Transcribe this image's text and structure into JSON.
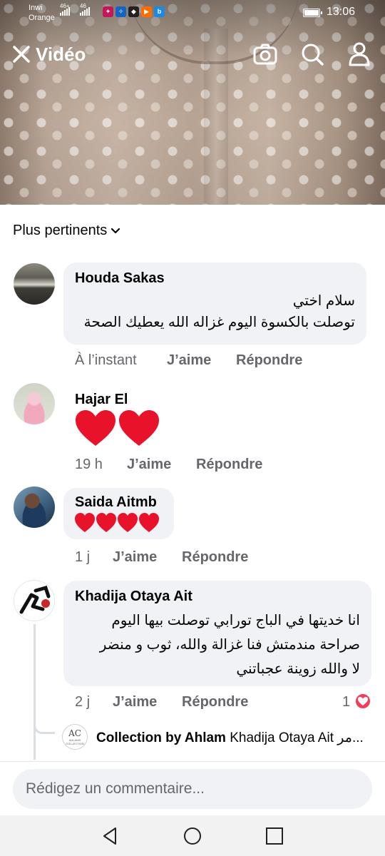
{
  "status_bar": {
    "carrier_1": "Inwi",
    "carrier_2": "Orange",
    "network_1": "46+",
    "network_2": "46",
    "time": "13:06"
  },
  "video_header": {
    "title": "Vidéo",
    "icons": [
      "close-icon",
      "camera-icon",
      "search-icon",
      "profile-icon"
    ]
  },
  "comments_header": {
    "sort_label": "Plus pertinents"
  },
  "comments": [
    {
      "author": "Houda Sakas",
      "lines": [
        "سلام اختي",
        "توصلت بالكسوة اليوم غزاله الله يعطيك الصحة"
      ],
      "time": "À l’instant",
      "like": "J’aime",
      "reply": "Répondre"
    },
    {
      "author": "Hajar El",
      "emoji": "❤❤",
      "time": "19 h",
      "like": "J’aime",
      "reply": "Répondre"
    },
    {
      "author": "Saida Aitmb",
      "emoji": "❤❤❤❤",
      "time": "1 j",
      "like": "J’aime",
      "reply": "Répondre"
    },
    {
      "author": "Khadija Otaya Ait",
      "lines": [
        "انا خديتها في الباج تورابي توصلت بيها اليوم",
        "صراحة مندمتش فنا غزالة والله، ثوب و منضر",
        "لا والله زوينة عجباتني"
      ],
      "time": "2 j",
      "like": "J’aime",
      "reply": "Répondre",
      "reaction_count": "1"
    }
  ],
  "reply_preview": {
    "author": "Collection by Ahlam",
    "mention": "Khadija Otaya Ait",
    "snippet": "مر...",
    "avatar_text": "AC",
    "avatar_subtext": "AHLAMS COLLECTION"
  },
  "composer": {
    "placeholder": "Rédigez un commentaire..."
  },
  "colors": {
    "bubble": "#f0f2f5",
    "meta_text": "#65676b",
    "heart_red": "#f33e58",
    "emoji_red": "#e8132b"
  }
}
